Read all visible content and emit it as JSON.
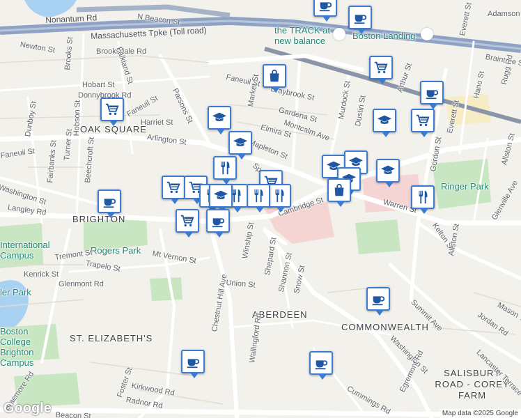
{
  "map": {
    "neighborhoods": [
      {
        "id": "oak-square",
        "text": "OAK SQUARE"
      },
      {
        "id": "brighton",
        "text": "BRIGHTON"
      },
      {
        "id": "aberdeen",
        "text": "ABERDEEN"
      },
      {
        "id": "commonwealth",
        "text": "COMMONWEALTH"
      },
      {
        "id": "st-elizabeths",
        "text": "ST. ELIZABETH'S"
      },
      {
        "id": "salisbury-road",
        "text": "SALISBURY ROAD - COREY FARM"
      }
    ],
    "places": [
      {
        "id": "the-track",
        "text": "the TRACK at new balance"
      },
      {
        "id": "boston-landing",
        "text": "Boston Landing"
      },
      {
        "id": "rogers-park",
        "text": "Rogers Park"
      },
      {
        "id": "ringer-park",
        "text": "Ringer Park"
      },
      {
        "id": "intl-campus",
        "text": "International Campus"
      },
      {
        "id": "bc-brighton",
        "text": "Boston College Brighton Campus"
      },
      {
        "id": "chandler-park",
        "text": "ler Park"
      }
    ],
    "highways": [
      {
        "id": "mass-pike",
        "text": "Massachusetts Tpke (Toll road)"
      },
      {
        "id": "nonantum",
        "text": "Nonantum Rd"
      }
    ],
    "streets": [
      "N Beacon St",
      "Newton St",
      "Brooksdale Rd",
      "Brooks St",
      "Hobart St",
      "Donnybrook Rd",
      "Falkland St",
      "Faneuil St",
      "Harriet St",
      "Parsons St",
      "Turner St",
      "Hobson St",
      "Dunboy St",
      "Fairbanks St",
      "Beechcroft St",
      "Arlington St",
      "Faneuil St",
      "Washington St",
      "Langley Rd",
      "Mapleton St",
      "Elmira St",
      "Gardena St",
      "Montcalm Ave",
      "Faneuil St",
      "Braybrook St",
      "Market St",
      "Murdock St",
      "Dustin St",
      "Arthur St",
      "Everett St",
      "Adamson St",
      "Braintree St",
      "Hano St",
      "Rugg Rd",
      "Everett St",
      "Gordon St",
      "Allston St",
      "Glenville Ave",
      "Kelton St",
      "Warren St",
      "Cambridge St",
      "Sparhawk St",
      "Winship St",
      "Shepard St",
      "Shannon St",
      "Snow St",
      "Union St",
      "Mt Vernon St",
      "Tremont St",
      "Trapelo St",
      "Kenrick St",
      "Glenmont Rd",
      "Chestnut Hill Ave",
      "Wallingford Rd",
      "Allston St",
      "Summit Ave",
      "Jordan Rd",
      "Mason Ter",
      "Washington St",
      "Egremont Rd",
      "Lancaster Terrace",
      "Cummings Rd",
      "Foster St",
      "Kirkwood Rd",
      "Radnor Rd",
      "Beacon St",
      "Braemore Rd"
    ],
    "markers": [
      {
        "type": "cafe",
        "icon": "coffee-cup-icon"
      },
      {
        "type": "cafe",
        "icon": "coffee-cup-icon"
      },
      {
        "type": "shopping",
        "icon": "shopping-bag-icon"
      },
      {
        "type": "grocery",
        "icon": "shopping-cart-icon"
      },
      {
        "type": "cafe",
        "icon": "coffee-cup-icon"
      },
      {
        "type": "grocery",
        "icon": "shopping-cart-icon"
      },
      {
        "type": "school",
        "icon": "graduation-cap-icon"
      },
      {
        "type": "grocery",
        "icon": "shopping-cart-icon"
      },
      {
        "type": "school",
        "icon": "graduation-cap-icon"
      },
      {
        "type": "school",
        "icon": "graduation-cap-icon"
      },
      {
        "type": "restaurant",
        "icon": "fork-knife-icon"
      },
      {
        "type": "school",
        "icon": "graduation-cap-icon"
      },
      {
        "type": "school",
        "icon": "graduation-cap-icon"
      },
      {
        "type": "school",
        "icon": "graduation-cap-icon"
      },
      {
        "type": "school",
        "icon": "graduation-cap-icon"
      },
      {
        "type": "shopping",
        "icon": "shopping-bag-icon"
      },
      {
        "type": "grocery",
        "icon": "shopping-cart-icon"
      },
      {
        "type": "grocery",
        "icon": "shopping-cart-icon"
      },
      {
        "type": "cafe",
        "icon": "coffee-cup-icon"
      },
      {
        "type": "grocery",
        "icon": "shopping-cart-icon"
      },
      {
        "type": "restaurant",
        "icon": "fork-knife-icon"
      },
      {
        "type": "restaurant",
        "icon": "fork-knife-icon"
      },
      {
        "type": "restaurant",
        "icon": "fork-knife-icon"
      },
      {
        "type": "restaurant",
        "icon": "fork-knife-icon"
      },
      {
        "type": "restaurant",
        "icon": "fork-knife-icon"
      },
      {
        "type": "school",
        "icon": "graduation-cap-icon"
      },
      {
        "type": "grocery",
        "icon": "shopping-cart-icon"
      },
      {
        "type": "cafe",
        "icon": "coffee-cup-icon"
      },
      {
        "type": "cafe",
        "icon": "coffee-cup-icon"
      },
      {
        "type": "cafe",
        "icon": "coffee-cup-icon"
      },
      {
        "type": "cafe",
        "icon": "coffee-cup-icon"
      }
    ],
    "attribution": "Map data ©2025 Google",
    "logo": "Google",
    "colors": {
      "marker_border": "#3b7bd0",
      "park": "#c8e6c1",
      "water": "#a8d1f2",
      "highway": "#8ea3c4",
      "hospital": "#f5d4d4"
    }
  }
}
